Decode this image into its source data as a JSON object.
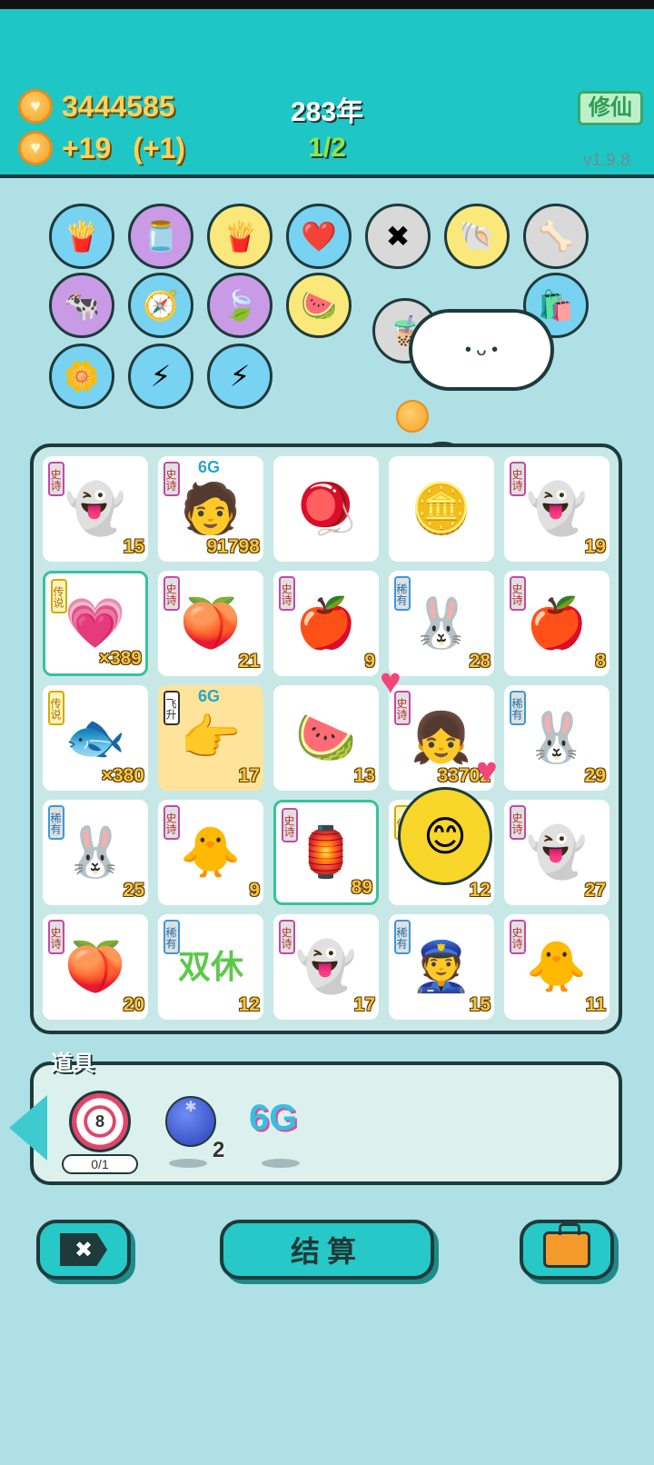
{
  "header": {
    "coins": "3444585",
    "income": "+19",
    "income_bonus": "(+1)",
    "year": "283年",
    "progress": "1/2",
    "xiuxian_label": "修仙",
    "version": "v1.9.8"
  },
  "upgrades": [
    {
      "icon": "fries-icon",
      "glyph": "🍟"
    },
    {
      "icon": "jar-icon",
      "glyph": "🫙"
    },
    {
      "icon": "fries-icon",
      "glyph": "🍟"
    },
    {
      "icon": "heart-fan-icon",
      "glyph": "❤️"
    },
    {
      "icon": "tag-x-icon",
      "glyph": "✖"
    },
    {
      "icon": "shell-icon",
      "glyph": "🐚"
    },
    {
      "icon": "bone-bowl-icon",
      "glyph": "🦴"
    },
    {
      "icon": "cow-poster-icon",
      "glyph": "🐄"
    },
    {
      "icon": "compass-icon",
      "glyph": "🧭"
    },
    {
      "icon": "leaf-icon",
      "glyph": "🍃"
    },
    {
      "icon": "fruit-bowl-icon",
      "glyph": "🍉"
    },
    {
      "icon": "bubble-tea-icon",
      "glyph": "🧋"
    },
    {
      "icon": "sack-icon",
      "glyph": "🛍️"
    },
    {
      "icon": "flower-pot-icon",
      "glyph": "🌼"
    },
    {
      "icon": "energy-sack-icon",
      "glyph": "⚡"
    },
    {
      "icon": "energy-sack-icon",
      "glyph": "⚡"
    }
  ],
  "board": [
    {
      "emoji": "👻",
      "badge": "史诗",
      "rarity": "epic",
      "count": "15"
    },
    {
      "emoji": "🧑",
      "badge": "史诗",
      "rarity": "epic",
      "count": "91798",
      "tag": "6G"
    },
    {
      "emoji": "🪀",
      "badge": "",
      "rarity": "",
      "count": ""
    },
    {
      "emoji": "🪙",
      "badge": "",
      "rarity": "",
      "count": ""
    },
    {
      "emoji": "👻",
      "badge": "史诗",
      "rarity": "epic",
      "count": "19"
    },
    {
      "emoji": "💗",
      "badge": "传说",
      "rarity": "legend",
      "count": "×389",
      "highlight": true
    },
    {
      "emoji": "🍑",
      "badge": "史诗",
      "rarity": "epic",
      "count": "21"
    },
    {
      "emoji": "🍎",
      "badge": "史诗",
      "rarity": "epic",
      "count": "9"
    },
    {
      "emoji": "🐰",
      "badge": "稀有",
      "rarity": "rare",
      "count": "28"
    },
    {
      "emoji": "🍎",
      "badge": "史诗",
      "rarity": "epic",
      "count": "8"
    },
    {
      "emoji": "🐟",
      "badge": "传说",
      "rarity": "legend",
      "count": "×380"
    },
    {
      "emoji": "👉",
      "badge": "飞升",
      "rarity": "fly",
      "count": "17",
      "tag": "6G",
      "yellow": true
    },
    {
      "emoji": "🍉",
      "badge": "",
      "rarity": "",
      "count": "13"
    },
    {
      "emoji": "👧",
      "badge": "史诗",
      "rarity": "epic",
      "count": "33702"
    },
    {
      "emoji": "🐰",
      "badge": "稀有",
      "rarity": "rare",
      "count": "29"
    },
    {
      "emoji": "🐰",
      "badge": "稀有",
      "rarity": "rare",
      "count": "25"
    },
    {
      "emoji": "🐥",
      "badge": "史诗",
      "rarity": "epic",
      "count": "9"
    },
    {
      "emoji": "🏮",
      "badge": "史诗",
      "rarity": "epic",
      "count": "89",
      "highlight": true
    },
    {
      "emoji": "",
      "badge": "传",
      "rarity": "legend",
      "count": "12"
    },
    {
      "emoji": "👻",
      "badge": "史诗",
      "rarity": "epic",
      "count": "27"
    },
    {
      "emoji": "🍑",
      "badge": "史诗",
      "rarity": "epic",
      "count": "20"
    },
    {
      "emoji": "双休",
      "badge": "稀有",
      "rarity": "rare",
      "count": "12",
      "text_art": true
    },
    {
      "emoji": "👻",
      "badge": "史诗",
      "rarity": "epic",
      "count": "17"
    },
    {
      "emoji": "👮",
      "badge": "稀有",
      "rarity": "rare",
      "count": "15"
    },
    {
      "emoji": "🐥",
      "badge": "史诗",
      "rarity": "epic",
      "count": "11"
    }
  ],
  "props": {
    "title": "道具",
    "target_number": "8",
    "target_progress": "0/1",
    "blueberry_count": "2",
    "sixg_label": "6G"
  },
  "actions": {
    "settle_label": "结算",
    "close_label": "✖"
  },
  "colors": {
    "header_bg": "#1ec6c6",
    "page_bg": "#aee0e6",
    "coin_text": "#ffd15a",
    "progress_text": "#8ee64a"
  }
}
